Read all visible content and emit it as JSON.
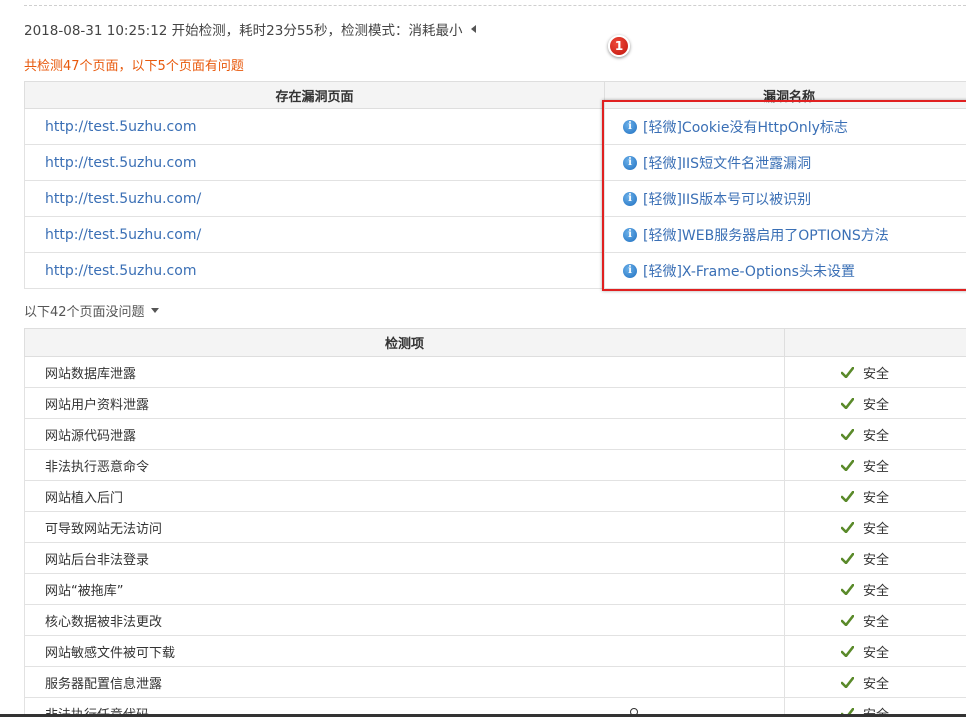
{
  "header": {
    "scan_info": "2018-08-31 10:25:12 开始检测，耗时23分55秒，检测模式：消耗最小",
    "summary": "共检测47个页面，以下5个页面有问题",
    "badge": "1"
  },
  "vuln_table": {
    "col_page": "存在漏洞页面",
    "col_name": "漏洞名称",
    "rows": [
      {
        "page": "http://test.5uzhu.com",
        "name": "[轻微]Cookie没有HttpOnly标志"
      },
      {
        "page": "http://test.5uzhu.com",
        "name": "[轻微]IIS短文件名泄露漏洞"
      },
      {
        "page": "http://test.5uzhu.com/",
        "name": "[轻微]IIS版本号可以被识别"
      },
      {
        "page": "http://test.5uzhu.com/",
        "name": "[轻微]WEB服务器启用了OPTIONS方法"
      },
      {
        "page": "http://test.5uzhu.com",
        "name": "[轻微]X-Frame-Options头未设置"
      }
    ]
  },
  "ok_section": {
    "toggle_label": "以下42个页面没问题"
  },
  "check_table": {
    "col_item": "检测项",
    "rows": [
      {
        "item": "网站数据库泄露",
        "status": "安全"
      },
      {
        "item": "网站用户资料泄露",
        "status": "安全"
      },
      {
        "item": "网站源代码泄露",
        "status": "安全"
      },
      {
        "item": "非法执行恶意命令",
        "status": "安全"
      },
      {
        "item": "网站植入后门",
        "status": "安全"
      },
      {
        "item": "可导致网站无法访问",
        "status": "安全"
      },
      {
        "item": "网站后台非法登录",
        "status": "安全"
      },
      {
        "item": "网站“被拖库”",
        "status": "安全"
      },
      {
        "item": "核心数据被非法更改",
        "status": "安全"
      },
      {
        "item": "网站敏感文件被可下载",
        "status": "安全"
      },
      {
        "item": "服务器配置信息泄露",
        "status": "安全"
      },
      {
        "item": "非法执行任意代码",
        "status": "安全"
      }
    ]
  },
  "colors": {
    "summary": "#e8590c",
    "link": "#3a6fb5",
    "check": "#5a8a2a",
    "highlight_box": "#e02020"
  }
}
